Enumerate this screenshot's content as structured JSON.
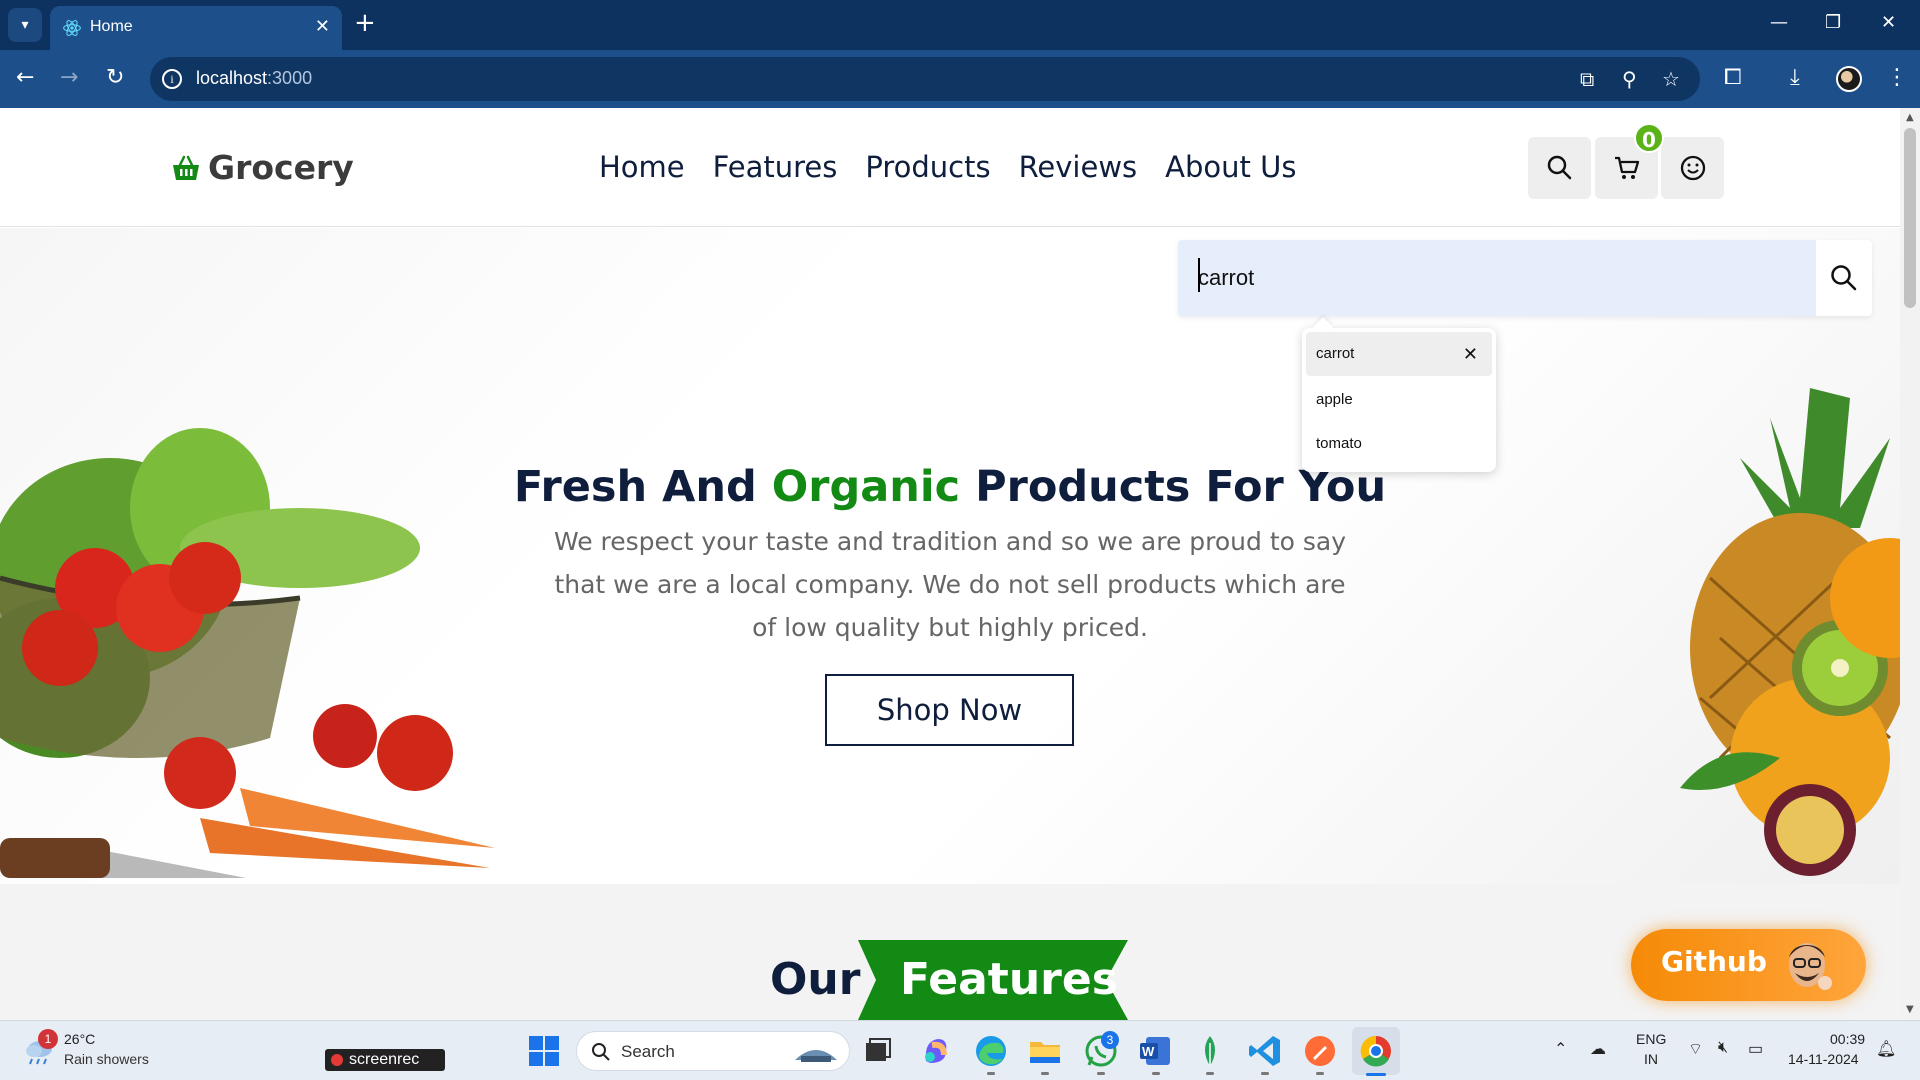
{
  "browser": {
    "tab_title": "Home",
    "url_host": "localhost",
    "url_port": ":3000"
  },
  "site": {
    "logo": "Grocery",
    "nav": [
      "Home",
      "Features",
      "Products",
      "Reviews",
      "About Us"
    ],
    "cart_count": "0",
    "accent_color": "#138a14"
  },
  "search": {
    "value": "carrot",
    "suggestions": [
      "carrot",
      "apple",
      "tomato"
    ]
  },
  "hero": {
    "title_part1": "Fresh And ",
    "title_accent": "Organic",
    "title_part2": " Products For You",
    "description": "We respect your taste and tradition and so we are proud to say that we are a local company. We do not sell products which are of low quality but highly priced.",
    "cta": "Shop Now"
  },
  "features": {
    "title_our": "Our",
    "title_features": "Features"
  },
  "github_button": "Github",
  "taskbar": {
    "weather_temp": "26°C",
    "weather_desc": "Rain showers",
    "weather_badge": "1",
    "screenrec": "screenrec",
    "search_placeholder": "Search",
    "whatsapp_badge": "3",
    "lang_top": "ENG",
    "lang_bottom": "IN",
    "time": "00:39",
    "date": "14-11-2024"
  }
}
